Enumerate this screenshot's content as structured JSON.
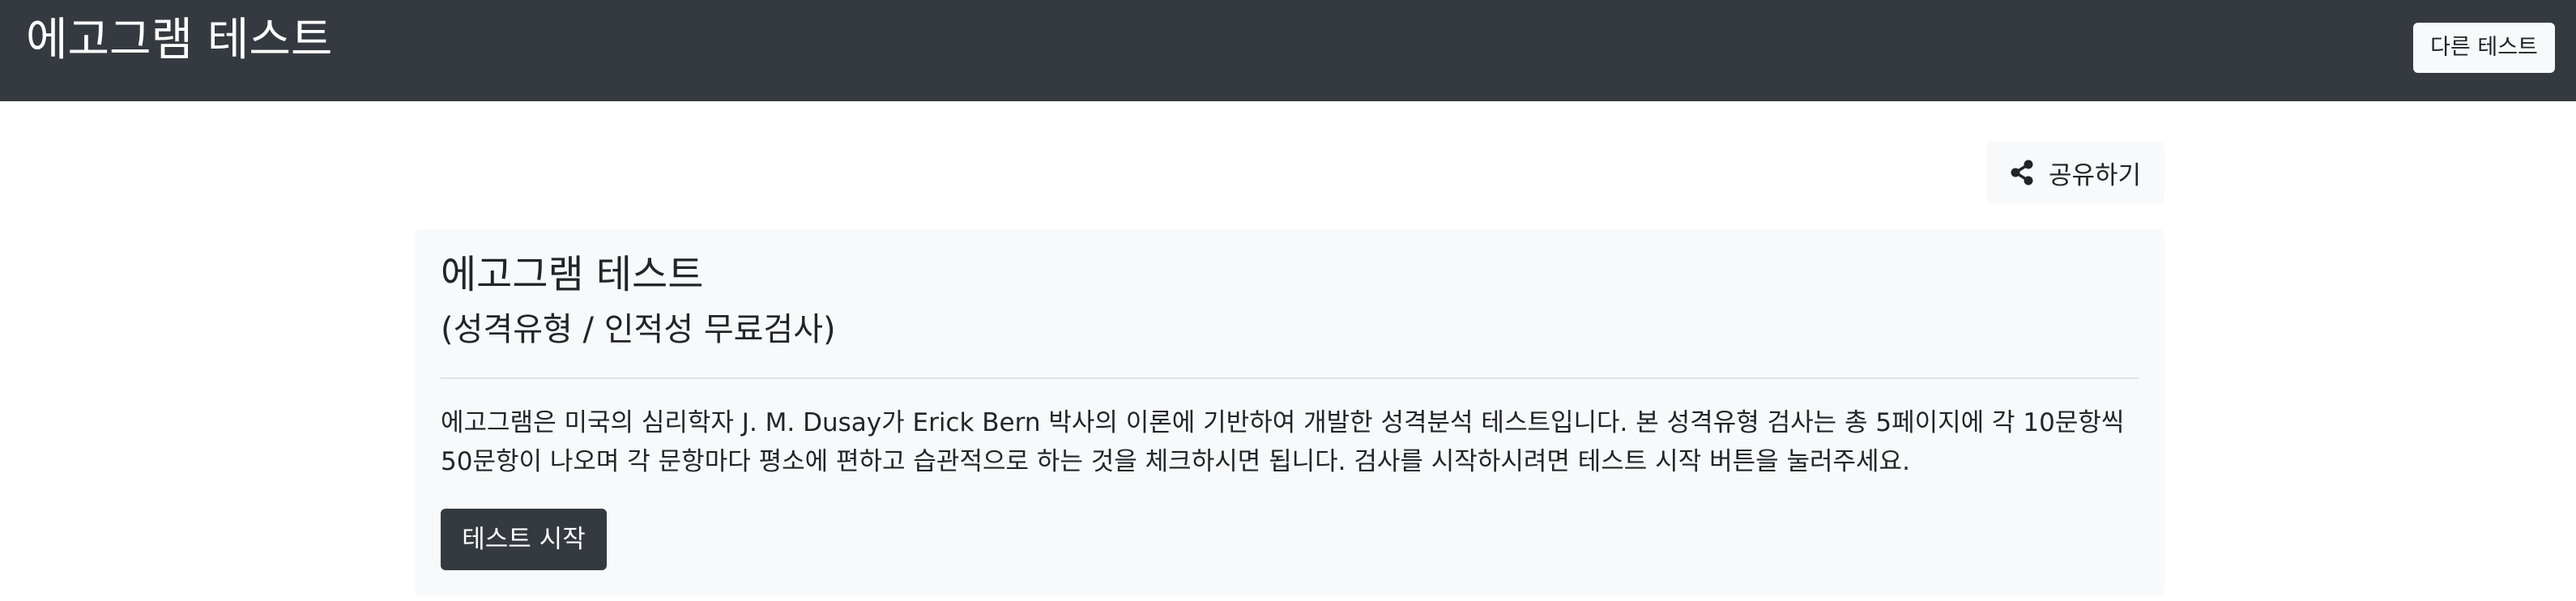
{
  "navbar": {
    "brand": "에고그램 테스트",
    "other_test_label": "다른 테스트",
    "background": "#343a40"
  },
  "share": {
    "icon": "share-icon",
    "label": "공유하기"
  },
  "card": {
    "title": "에고그램 테스트",
    "subtitle": "(성격유형 / 인적성 무료검사)",
    "description": "에고그램은 미국의 심리학자 J. M. Dusay가 Erick Bern 박사의 이론에 기반하여 개발한 성격분석 테스트입니다. 본 성격유형 검사는 총 5페이지에 각 10문항씩 50문항이 나오며 각 문항마다 평소에 편하고 습관적으로 하는 것을 체크하시면 됩니다. 검사를 시작하시려면 테스트 시작 버튼을 눌러주세요.",
    "start_label": "테스트 시작",
    "background": "#f8f9fa"
  }
}
